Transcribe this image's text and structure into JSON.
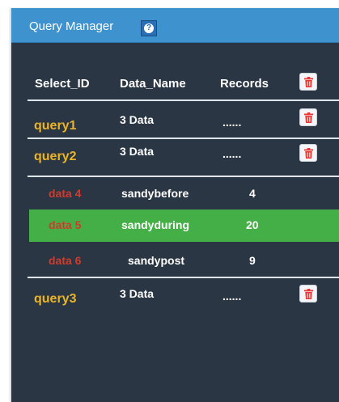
{
  "panel": {
    "title": "Query Manager",
    "help_icon": "question-circle-icon"
  },
  "table": {
    "headers": {
      "select_id": "Select_ID",
      "data_name": "Data_Name",
      "records": "Records"
    },
    "delete_icon": "trash-icon",
    "queries": [
      {
        "select_id": "query1",
        "data_name": "3 Data",
        "records": "......"
      },
      {
        "select_id": "query2",
        "data_name": "3 Data",
        "records": "......",
        "children": [
          {
            "select_id": "data 4",
            "data_name": "sandybefore",
            "records": "4"
          },
          {
            "select_id": "data 5",
            "data_name": "sandyduring",
            "records": "20",
            "selected": true
          },
          {
            "select_id": "data 6",
            "data_name": "sandypost",
            "records": "9"
          }
        ]
      },
      {
        "select_id": "query3",
        "data_name": "3 Data",
        "records": "......"
      }
    ]
  },
  "colors": {
    "header": "#3e93cf",
    "panel": "#2b3645",
    "query_id": "#e9b32a",
    "data_id": "#cf3b2d",
    "selected_row": "#43af46",
    "delete_icon": "#e53935"
  }
}
